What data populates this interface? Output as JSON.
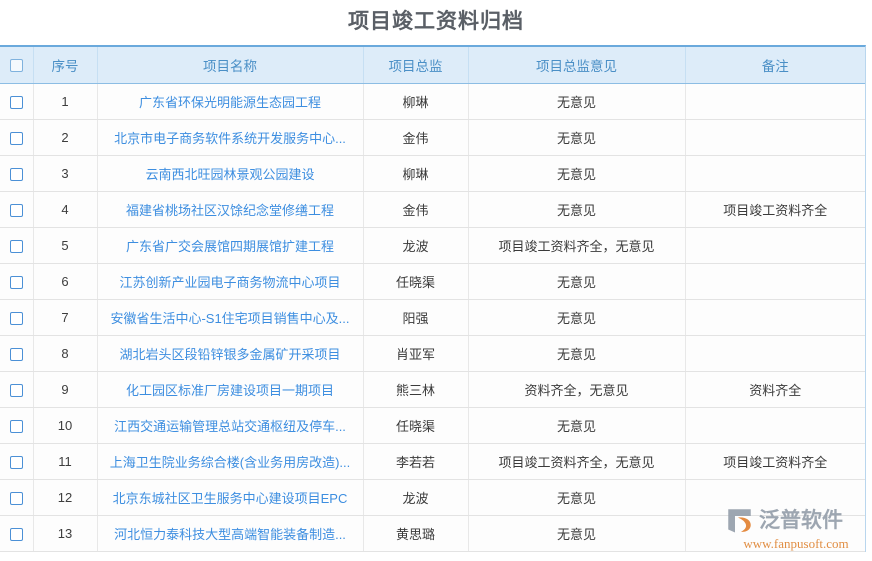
{
  "page": {
    "title": "项目竣工资料归档"
  },
  "table": {
    "columns": [
      {
        "key": "check",
        "label": "",
        "icon": "checkbox-icon"
      },
      {
        "key": "index",
        "label": "序号"
      },
      {
        "key": "name",
        "label": "项目名称"
      },
      {
        "key": "mgr",
        "label": "项目总监"
      },
      {
        "key": "op",
        "label": "项目总监意见"
      },
      {
        "key": "remark",
        "label": "备注"
      }
    ],
    "rows": [
      {
        "index": "1",
        "name": "广东省环保光明能源生态园工程",
        "mgr": "柳琳",
        "op": "无意见",
        "remark": ""
      },
      {
        "index": "2",
        "name": "北京市电子商务软件系统开发服务中心...",
        "mgr": "金伟",
        "op": "无意见",
        "remark": ""
      },
      {
        "index": "3",
        "name": "云南西北旺园林景观公园建设",
        "mgr": "柳琳",
        "op": "无意见",
        "remark": ""
      },
      {
        "index": "4",
        "name": "福建省桃场社区汉馀纪念堂修缮工程",
        "mgr": "金伟",
        "op": "无意见",
        "remark": "项目竣工资料齐全"
      },
      {
        "index": "5",
        "name": "广东省广交会展馆四期展馆扩建工程",
        "mgr": "龙波",
        "op": "项目竣工资料齐全，无意见",
        "remark": ""
      },
      {
        "index": "6",
        "name": "江苏创新产业园电子商务物流中心项目",
        "mgr": "任晓渠",
        "op": "无意见",
        "remark": ""
      },
      {
        "index": "7",
        "name": "安徽省生活中心-S1住宅项目销售中心及...",
        "mgr": "阳强",
        "op": "无意见",
        "remark": ""
      },
      {
        "index": "8",
        "name": "湖北岩头区段铅锌银多金属矿开采项目",
        "mgr": "肖亚军",
        "op": "无意见",
        "remark": ""
      },
      {
        "index": "9",
        "name": "化工园区标准厂房建设项目一期项目",
        "mgr": "熊三林",
        "op": "资料齐全，无意见",
        "remark": "资料齐全"
      },
      {
        "index": "10",
        "name": "江西交通运输管理总站交通枢纽及停车...",
        "mgr": "任晓渠",
        "op": "无意见",
        "remark": ""
      },
      {
        "index": "11",
        "name": "上海卫生院业务综合楼(含业务用房改造)...",
        "mgr": "李若若",
        "op": "项目竣工资料齐全，无意见",
        "remark": "项目竣工资料齐全"
      },
      {
        "index": "12",
        "name": "北京东城社区卫生服务中心建设项目EPC",
        "mgr": "龙波",
        "op": "无意见",
        "remark": ""
      },
      {
        "index": "13",
        "name": "河北恒力泰科技大型高端智能装备制造...",
        "mgr": "黄思璐",
        "op": "无意见",
        "remark": ""
      }
    ]
  },
  "watermark": {
    "brand": "泛普软件",
    "url": "www.fanpusoft.com",
    "icon": "fanpu-logo-icon"
  },
  "colors": {
    "header_bg": "#ddecf9",
    "header_text": "#4a8fc6",
    "link_text": "#3d8ee0",
    "title_text": "#5a5f66",
    "accent_border": "#6aa9dc",
    "watermark_url": "#e08a3c"
  }
}
